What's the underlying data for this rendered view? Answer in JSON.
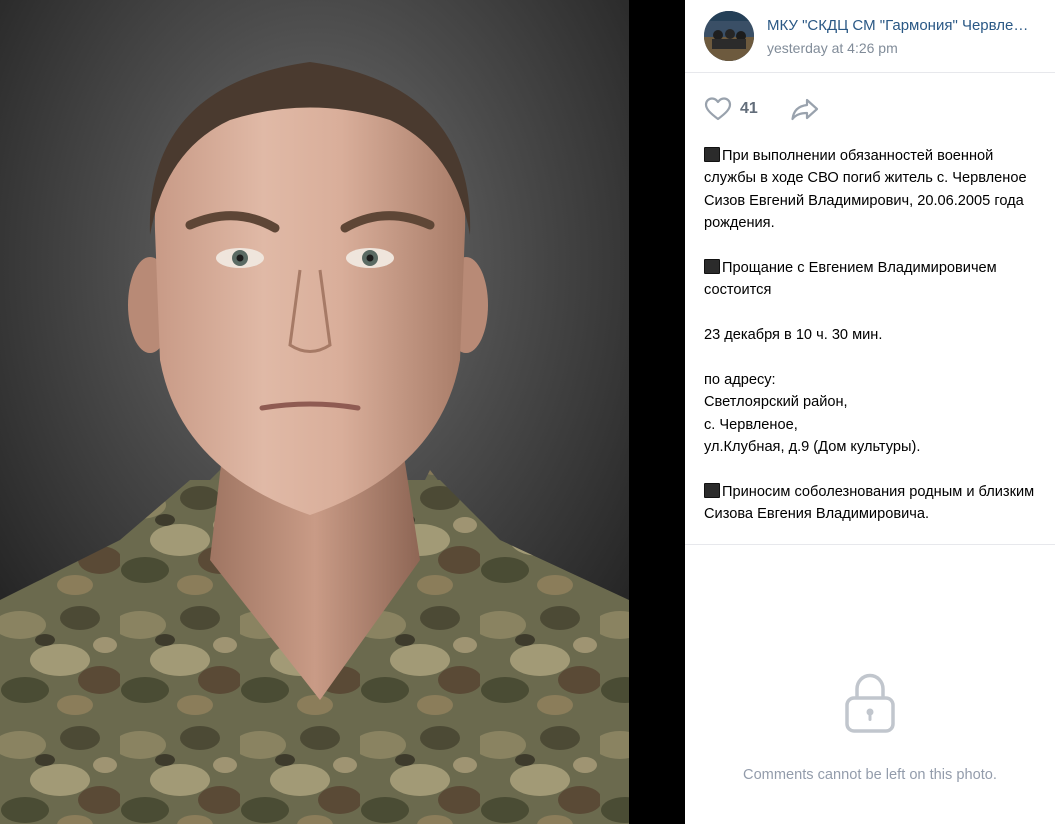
{
  "author": {
    "name": "МКУ \"СКДЦ СМ \"Гармония\" Червле…",
    "time": "yesterday at 4:26 pm"
  },
  "actions": {
    "like_count": "41",
    "like_icon": "heart-icon",
    "share_icon": "share-arrow-icon"
  },
  "post": {
    "p1": "При выполнении обязанностей военной службы в ходе СВО погиб житель с. Червленое Сизов Евгений Владимирович, 20.06.2005 года рождения.",
    "p2": "Прощание с Евгением Владимировичем состоится",
    "p3": "23 декабря в 10 ч. 30 мин.",
    "p4_line1": "по адресу:",
    "p4_line2": "Светлоярский район,",
    "p4_line3": "с. Червленое,",
    "p4_line4": "ул.Клубная, д.9 (Дом культуры).",
    "p5": "Приносим соболезнования родным и близким Сизова Евгения Владимировича."
  },
  "comments": {
    "lock_icon": "lock-icon",
    "disabled_text": "Comments cannot be left on this photo."
  },
  "colors": {
    "link": "#2a5885",
    "muted": "#818c99",
    "icon": "#99a2ad",
    "divider": "#e7e8ec"
  }
}
